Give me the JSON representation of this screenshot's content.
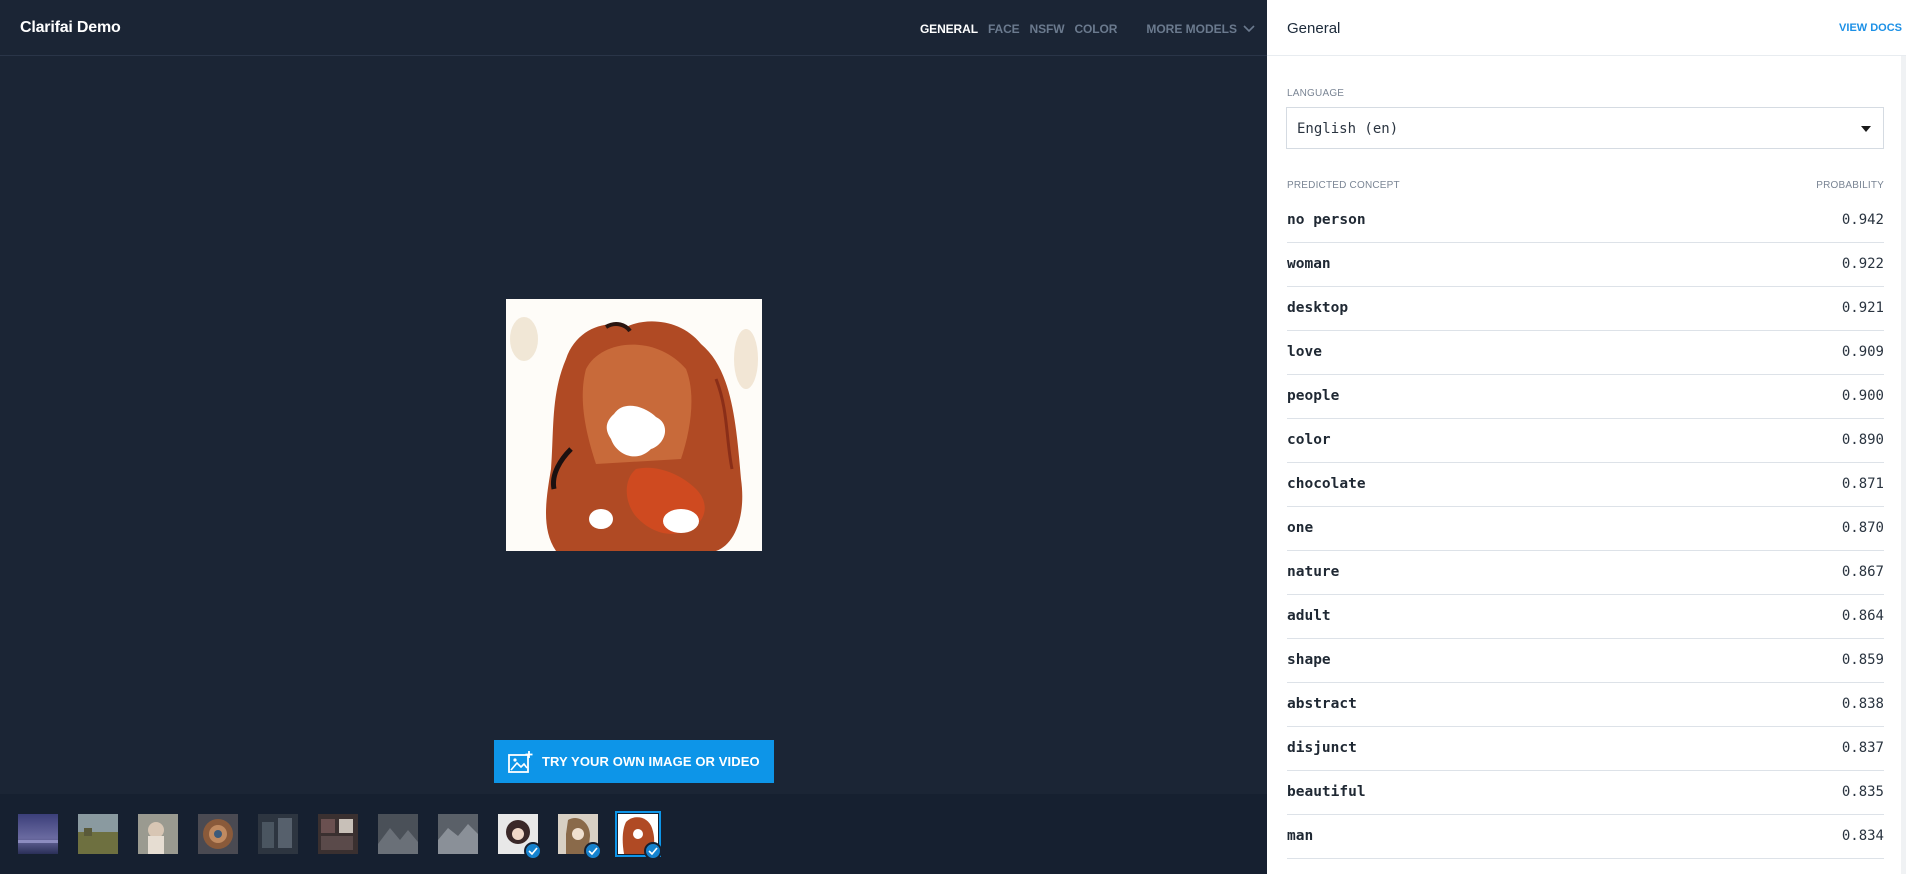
{
  "app": {
    "title": "Clarifai Demo"
  },
  "models": {
    "tabs": [
      {
        "label": "GENERAL",
        "active": true
      },
      {
        "label": "FACE",
        "active": false
      },
      {
        "label": "NSFW",
        "active": false
      },
      {
        "label": "COLOR",
        "active": false
      }
    ],
    "more_label": "MORE MODELS"
  },
  "upload": {
    "label": "TRY YOUR OWN IMAGE OR VIDEO"
  },
  "panel": {
    "title": "General",
    "view_docs": "VIEW DOCS",
    "language_label": "LANGUAGE",
    "language_value": "English (en)",
    "concept_header": "PREDICTED CONCEPT",
    "probability_header": "PROBABILITY",
    "concepts": [
      {
        "name": "no person",
        "probability": "0.942"
      },
      {
        "name": "woman",
        "probability": "0.922"
      },
      {
        "name": "desktop",
        "probability": "0.921"
      },
      {
        "name": "love",
        "probability": "0.909"
      },
      {
        "name": "people",
        "probability": "0.900"
      },
      {
        "name": "color",
        "probability": "0.890"
      },
      {
        "name": "chocolate",
        "probability": "0.871"
      },
      {
        "name": "one",
        "probability": "0.870"
      },
      {
        "name": "nature",
        "probability": "0.867"
      },
      {
        "name": "adult",
        "probability": "0.864"
      },
      {
        "name": "shape",
        "probability": "0.859"
      },
      {
        "name": "abstract",
        "probability": "0.838"
      },
      {
        "name": "disjunct",
        "probability": "0.837"
      },
      {
        "name": "beautiful",
        "probability": "0.835"
      },
      {
        "name": "man",
        "probability": "0.834"
      }
    ]
  },
  "colors": {
    "accent": "#0d95e8",
    "background": "#1b2535",
    "panel": "#ffffff"
  }
}
